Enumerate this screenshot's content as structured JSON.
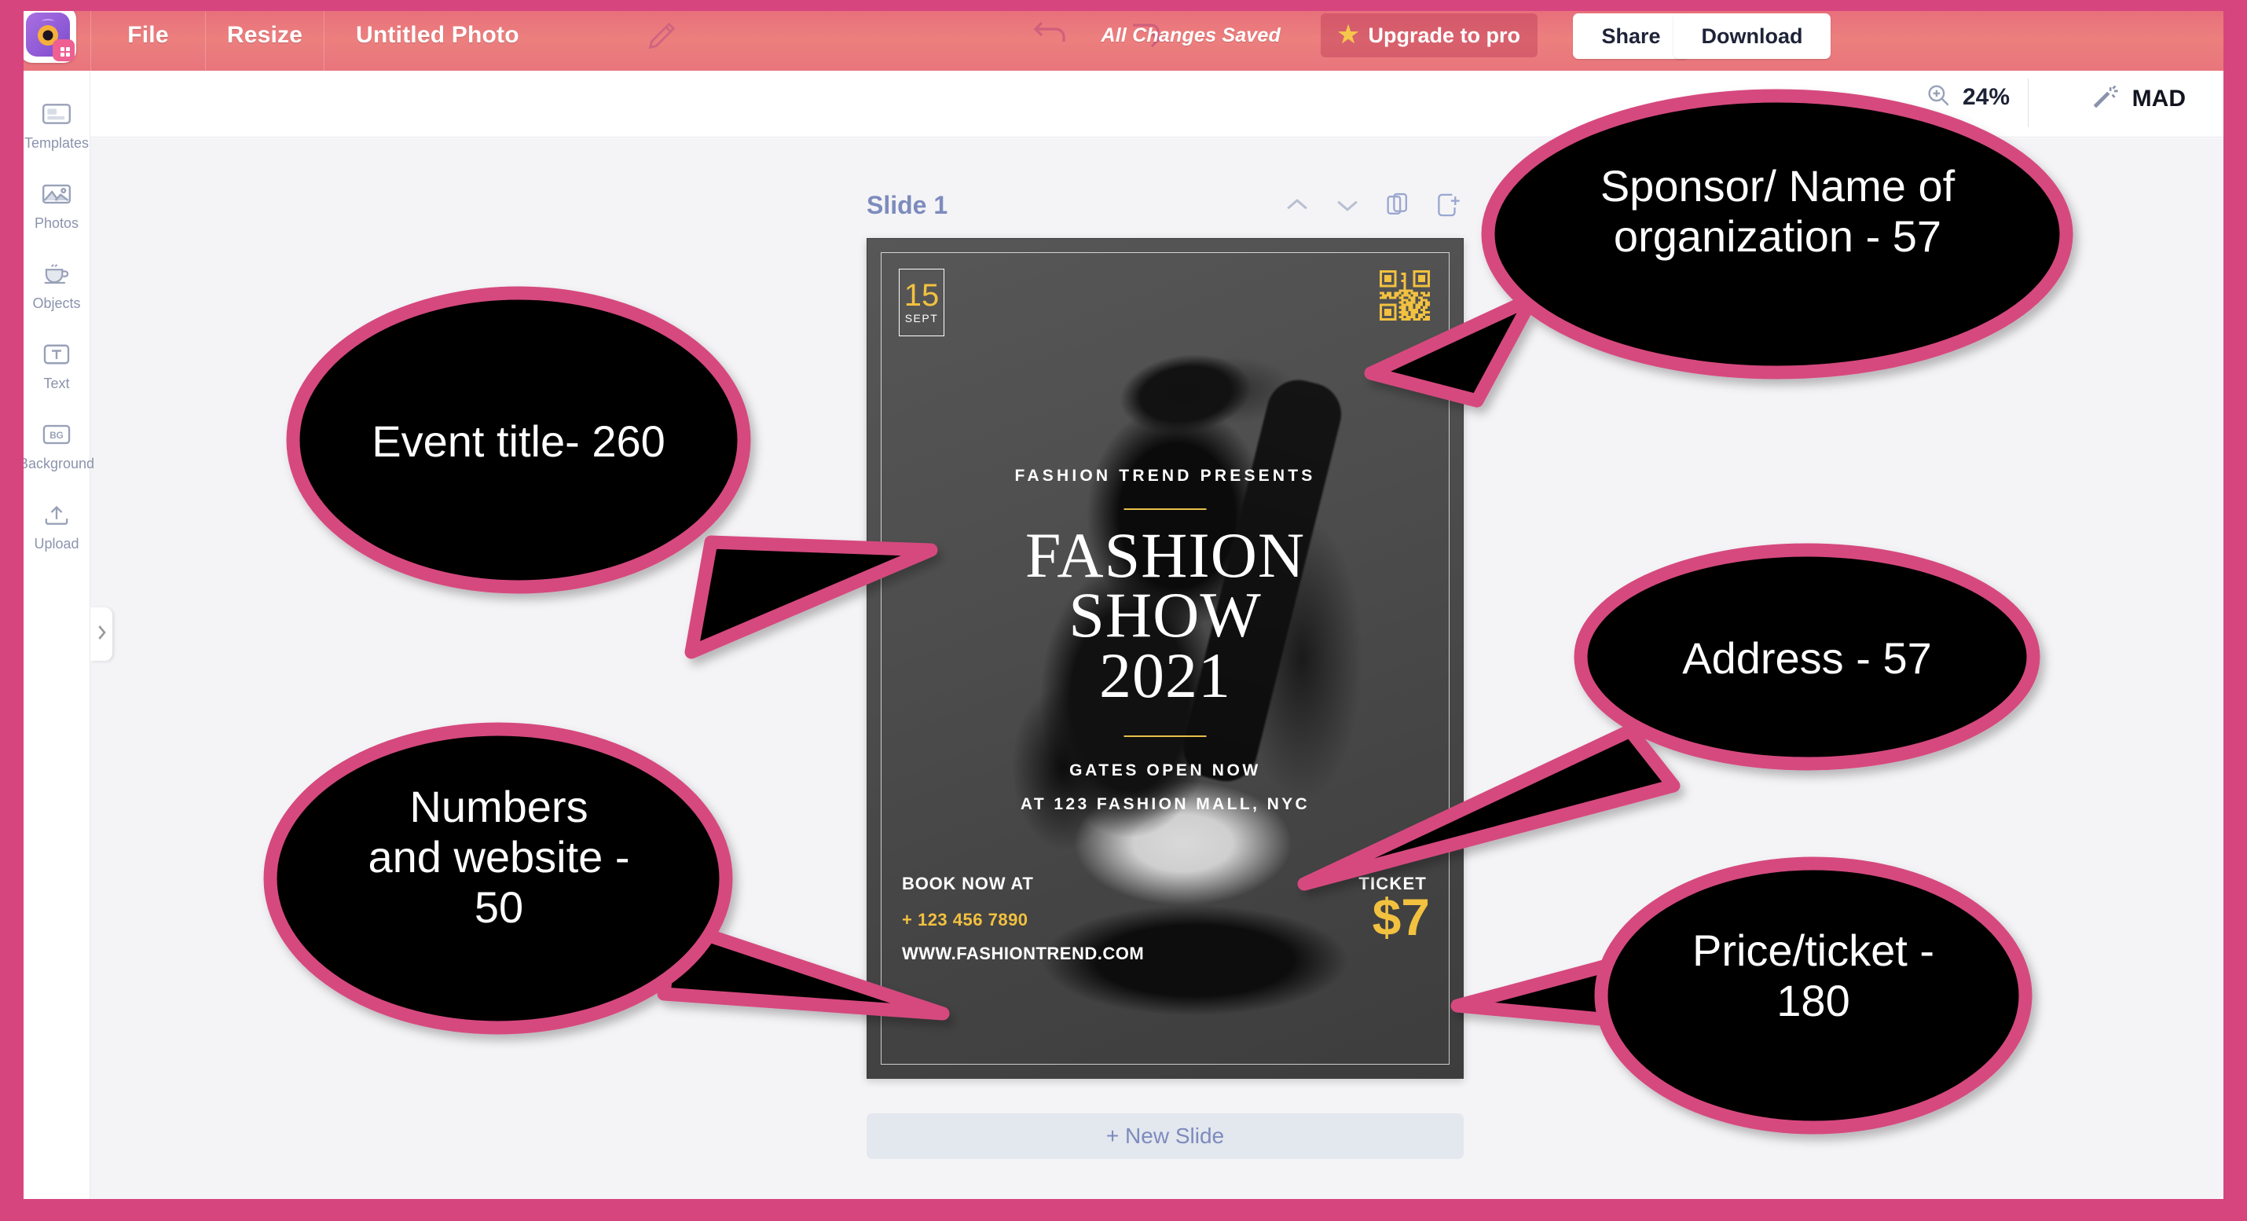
{
  "app": {
    "logo_icon": "camera-eye-logo-icon"
  },
  "topbar": {
    "file_label": "File",
    "resize_label": "Resize",
    "document_title": "Untitled Photo",
    "edit_icon": "pencil-icon",
    "undo_icon": "undo-arrow-icon",
    "redo_icon": "redo-arrow-icon",
    "save_status": "All Changes Saved",
    "upgrade_label": "Upgrade to pro",
    "upgrade_icon": "star-icon",
    "share_label": "Share",
    "download_label": "Download"
  },
  "secondbar": {
    "zoom_icon": "zoom-in-magnifier-icon",
    "zoom_level": "24%",
    "mad_icon": "magic-wand-icon",
    "mad_label": "MAD"
  },
  "sidebar": {
    "items": [
      {
        "label": "Templates",
        "icon": "templates-icon"
      },
      {
        "label": "Photos",
        "icon": "photos-image-icon"
      },
      {
        "label": "Objects",
        "icon": "objects-cup-icon"
      },
      {
        "label": "Text",
        "icon": "text-t-icon"
      },
      {
        "label": "Background",
        "icon": "background-bg-icon"
      },
      {
        "label": "Upload",
        "icon": "upload-arrow-icon"
      }
    ],
    "collapse_icon": "chevron-right-icon"
  },
  "canvas": {
    "slide_label": "Slide 1",
    "tools": [
      {
        "icon": "chevron-up-icon",
        "name": "move-slide-up"
      },
      {
        "icon": "chevron-down-icon",
        "name": "move-slide-down"
      },
      {
        "icon": "duplicate-icon",
        "name": "duplicate-slide"
      },
      {
        "icon": "add-slide-icon",
        "name": "add-slide"
      }
    ],
    "new_slide_label": "+ New Slide"
  },
  "poster": {
    "date_day": "15",
    "date_month": "SEPT",
    "qr_icon": "qr-code-icon",
    "presents": "FASHION TREND PRESENTS",
    "title_line1": "FASHION",
    "title_line2": "SHOW",
    "title_line3": "2021",
    "gates": "GATES OPEN NOW",
    "address": "AT 123 FASHION MALL, NYC",
    "book_label": "BOOK NOW AT",
    "phone": "+ 123 456 7890",
    "website": "WWW.FASHIONTREND.COM",
    "ticket_label": "TICKET",
    "price": "$7",
    "accent_yellow": "#f2c13f",
    "background": "#474747"
  },
  "callouts": [
    {
      "id": "event-title",
      "line1": "Event title- 260",
      "line2": ""
    },
    {
      "id": "sponsor",
      "line1": "Sponsor/ Name of",
      "line2": "organization - 57"
    },
    {
      "id": "address",
      "line1": "Address - 57",
      "line2": ""
    },
    {
      "id": "price-ticket",
      "line1": "Price/ticket -",
      "line2": "180"
    },
    {
      "id": "numbers-web",
      "line1": "Numbers",
      "line2": "and website -",
      "line3": "50"
    }
  ],
  "colors": {
    "brand_pink": "#d6457e",
    "topbar_pink": "#ec7f7e",
    "callout_fill": "#000000",
    "callout_stroke": "#d6487e",
    "sidebar_text": "#8b93ad",
    "slide_text": "#7d8bbd"
  }
}
